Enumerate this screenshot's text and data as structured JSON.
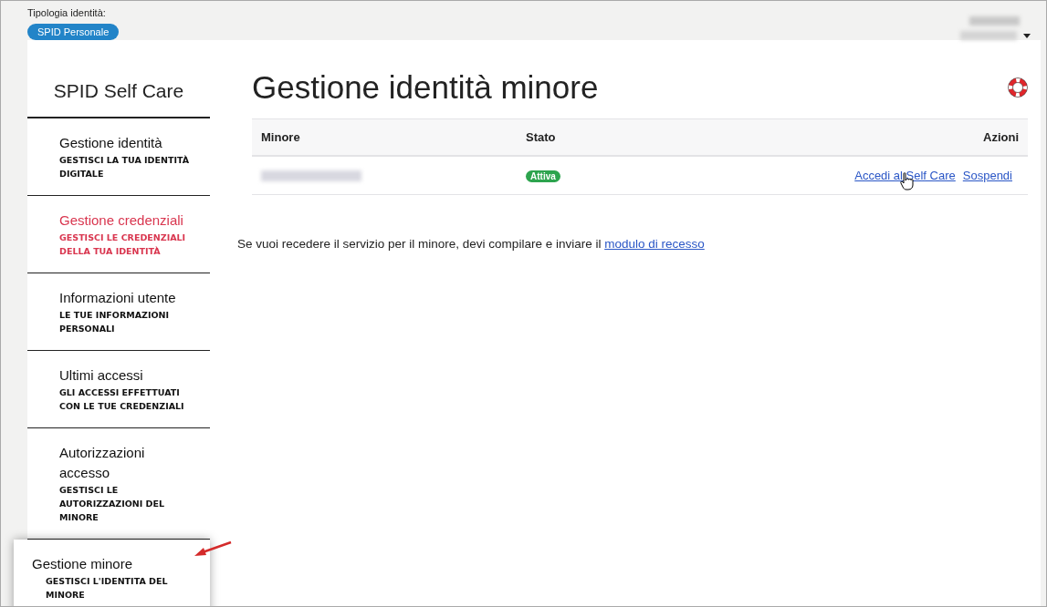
{
  "header": {
    "identity_type_label": "Tipologia identità:",
    "identity_type_badge": "SPID Personale"
  },
  "sidebar": {
    "title": "SPID Self Care",
    "items": [
      {
        "label": "Gestione identità",
        "sublabel": "GESTISCI LA TUA IDENTITÀ DIGITALE",
        "selected": false,
        "highlighted": false
      },
      {
        "label": "Gestione credenziali",
        "sublabel": "GESTISCI LE CREDENZIALI DELLA TUA IDENTITÀ",
        "selected": false,
        "highlighted": true
      },
      {
        "label": "Informazioni utente",
        "sublabel": "LE TUE INFORMAZIONI PERSONALI",
        "selected": false,
        "highlighted": false
      },
      {
        "label": "Ultimi accessi",
        "sublabel": "GLI ACCESSI EFFETTUATI CON LE TUE CREDENZIALI",
        "selected": false,
        "highlighted": false
      },
      {
        "label": "Autorizzazioni accesso",
        "sublabel": "GESTISCI LE AUTORIZZAZIONI DEL MINORE",
        "selected": false,
        "highlighted": false
      },
      {
        "label": "Gestione minore",
        "sublabel": "GESTISCI L'IDENTITA DEL MINORE",
        "selected": true,
        "highlighted": false
      }
    ]
  },
  "main": {
    "title": "Gestione identità minore",
    "table": {
      "columns": [
        "Minore",
        "Stato",
        "Azioni"
      ],
      "rows": [
        {
          "status": "Attiva",
          "actions": [
            "Accedi al Self Care",
            "Sospendi"
          ]
        }
      ]
    },
    "note": {
      "text": "Se vuoi recedere il servizio per il minore, devi compilare e inviare il",
      "link": "modulo di recesso"
    }
  }
}
